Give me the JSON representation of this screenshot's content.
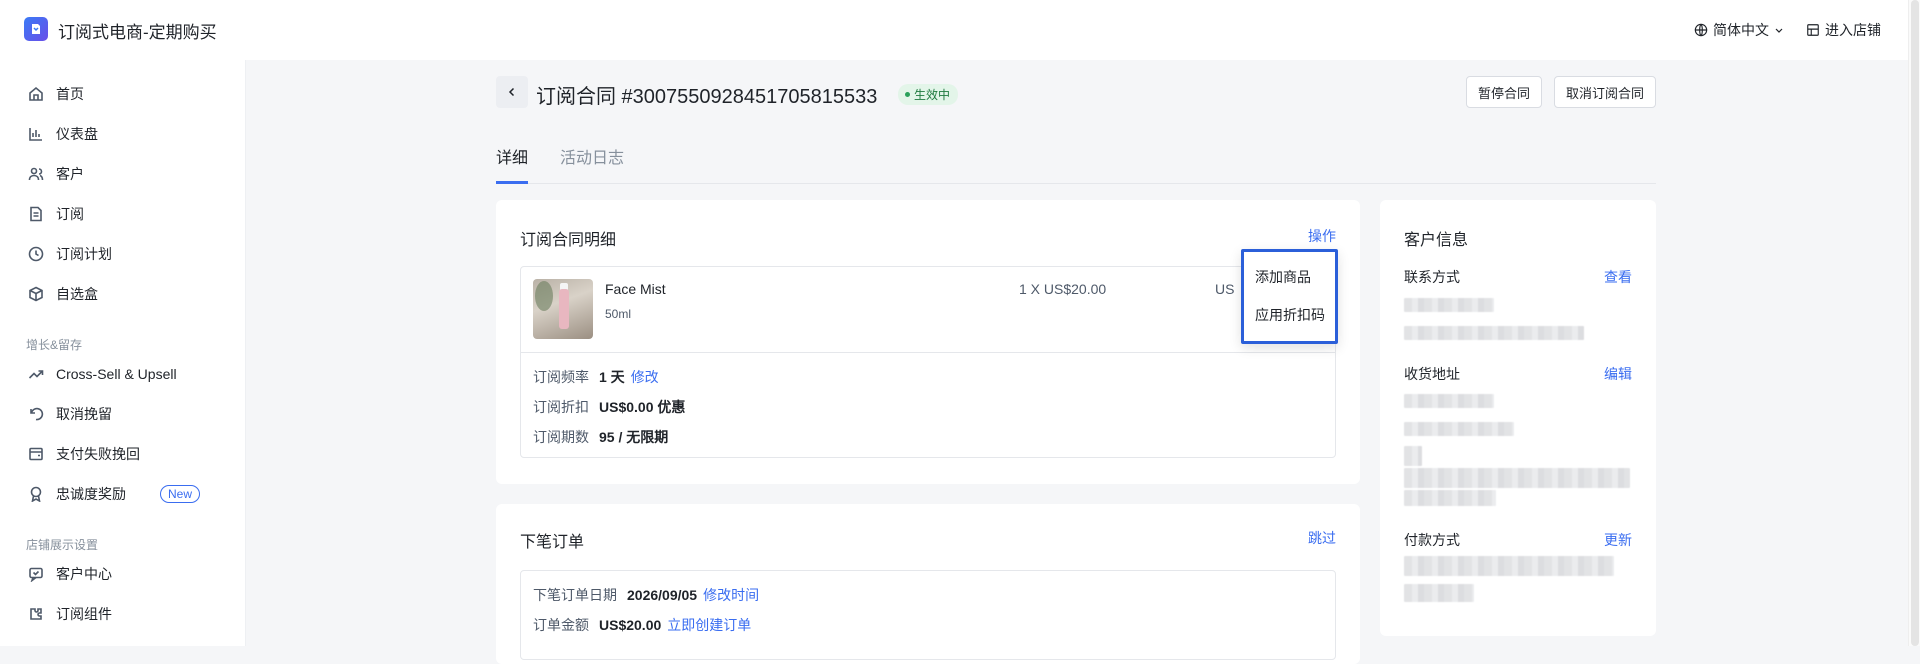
{
  "header": {
    "app_title": "订阅式电商-定期购买",
    "language": "简体中文",
    "enter_store": "进入店铺"
  },
  "sidebar": {
    "items": [
      {
        "label": "首页",
        "icon": "home-icon"
      },
      {
        "label": "仪表盘",
        "icon": "bar-chart-icon"
      },
      {
        "label": "客户",
        "icon": "users-icon"
      },
      {
        "label": "订阅",
        "icon": "document-icon"
      },
      {
        "label": "订阅计划",
        "icon": "plan-icon"
      },
      {
        "label": "自选盒",
        "icon": "box-icon"
      }
    ],
    "group_growth": "增长&留存",
    "growth_items": [
      {
        "label": "Cross-Sell & Upsell",
        "icon": "trend-up-icon"
      },
      {
        "label": "取消挽留",
        "icon": "undo-icon"
      },
      {
        "label": "支付失败挽回",
        "icon": "wallet-icon"
      },
      {
        "label": "忠诚度奖励",
        "icon": "award-icon",
        "badge": "New"
      }
    ],
    "group_store": "店铺展示设置",
    "store_items": [
      {
        "label": "客户中心",
        "icon": "message-icon"
      },
      {
        "label": "订阅组件",
        "icon": "puzzle-icon"
      }
    ]
  },
  "page": {
    "title": "订阅合同 #3007550928451705815533",
    "status": "生效中",
    "pause_button": "暂停合同",
    "cancel_button": "取消订阅合同",
    "tabs": [
      "详细",
      "活动日志"
    ]
  },
  "contract_details": {
    "title": "订阅合同明细",
    "action_link": "操作",
    "product": {
      "name": "Face Mist",
      "variant": "50ml",
      "unit_price": "1 X US$20.00",
      "total_partial": "US"
    },
    "rows": [
      {
        "label": "订阅频率",
        "value": "1 天",
        "link": "修改"
      },
      {
        "label": "订阅折扣",
        "value": "US$0.00 优惠",
        "link": ""
      },
      {
        "label": "订阅期数",
        "value": "95 / 无限期",
        "link": ""
      }
    ],
    "dropdown": [
      "添加商品",
      "应用折扣码"
    ]
  },
  "next_order": {
    "title": "下笔订单",
    "skip_link": "跳过",
    "rows": [
      {
        "label": "下笔订单日期",
        "value": "2026/09/05",
        "link": "修改时间"
      },
      {
        "label": "订单金额",
        "value": "US$20.00",
        "link": "立即创建订单"
      }
    ]
  },
  "customer_info": {
    "title": "客户信息",
    "contact_label": "联系方式",
    "contact_link": "查看",
    "address_label": "收货地址",
    "address_link": "编辑",
    "payment_label": "付款方式",
    "payment_link": "更新"
  },
  "colors": {
    "accent": "#3a6df0",
    "status_bg": "#e3f5e9",
    "highlight_border": "#2b5fd9"
  }
}
